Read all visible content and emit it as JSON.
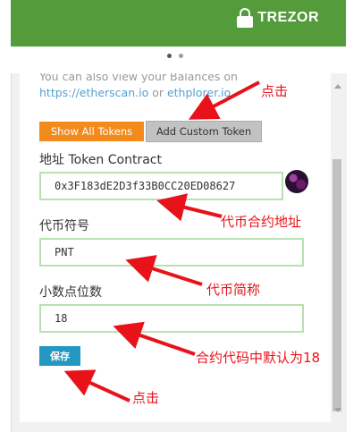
{
  "brand": {
    "name": "TREZOR",
    "icon": "lock-icon"
  },
  "carousel": {
    "dots": 2,
    "active_index": 0
  },
  "info": {
    "line1": "You can also view your Balances on",
    "link1": "https://etherscan.io",
    "or_text": " or ",
    "link2": "ethplorer.io"
  },
  "buttons": {
    "show_all": "Show All Tokens",
    "add_custom": "Add Custom Token",
    "save": "保存"
  },
  "fields": {
    "address_label": "地址 Token Contract",
    "address_value": "0x3F183dE2D3f33B0CC20ED08627",
    "symbol_label": "代币符号",
    "symbol_value": "PNT",
    "decimals_label": "小数点位数",
    "decimals_value": "18"
  },
  "annotations": {
    "click_top": "点击",
    "address_note": "代币合约地址",
    "symbol_note": "代币简称",
    "decimals_note": "合约代码中默认为18",
    "click_bottom": "点击"
  },
  "colors": {
    "banner": "#539b3b",
    "show_all_button": "#f28b1b",
    "save_button": "#2498c3",
    "annotation": "#e8121b",
    "field_border": "#b8e0b0"
  }
}
